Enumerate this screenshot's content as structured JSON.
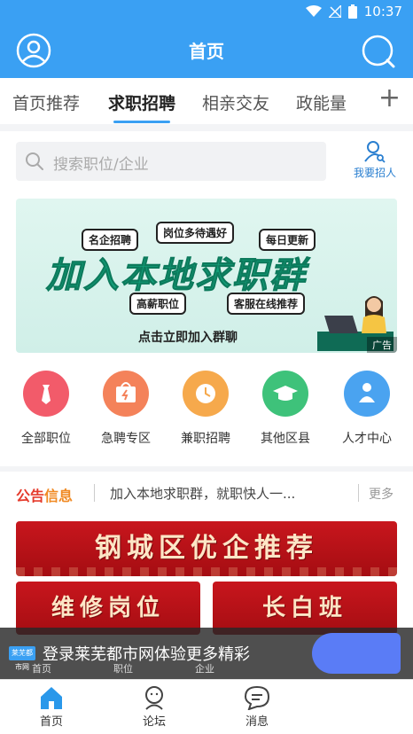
{
  "status_bar": {
    "time": "10:37"
  },
  "header": {
    "title": "首页"
  },
  "tabs": [
    {
      "label": "首页推荐"
    },
    {
      "label": "求职招聘"
    },
    {
      "label": "相亲交友"
    },
    {
      "label": "政能量"
    }
  ],
  "search": {
    "placeholder": "搜索职位/企业",
    "recruit_label": "我要招人"
  },
  "banner": {
    "tags": [
      "名企招聘",
      "岗位多待遇好",
      "每日更新",
      "高薪职位",
      "客服在线推荐"
    ],
    "title": "加入本地求职群",
    "cta": "点击立即加入群聊",
    "ad_label": "广告"
  },
  "categories": [
    {
      "label": "全部职位",
      "icon": "tie-icon",
      "color": "#f25b6a"
    },
    {
      "label": "急聘专区",
      "icon": "bag-icon",
      "color": "#f4825a"
    },
    {
      "label": "兼职招聘",
      "icon": "clock-icon",
      "color": "#f6a94c"
    },
    {
      "label": "其他区县",
      "icon": "graduation-cap-icon",
      "color": "#3ec27a"
    },
    {
      "label": "人才中心",
      "icon": "person-icon",
      "color": "#4aa3f0"
    }
  ],
  "notice": {
    "logo_a": "公告",
    "logo_b": "信息",
    "text": "加入本地求职群，就职快人一...",
    "more": "更多"
  },
  "promos": {
    "main": "钢城区优企推荐",
    "left": "维修岗位",
    "right": "长白班"
  },
  "overlay": {
    "logo": "莱芜都市网",
    "text": "登录莱芜都市网体验更多精彩",
    "ghost_labels": [
      "首页",
      "职位",
      "企业"
    ]
  },
  "bottom_nav": [
    {
      "label": "首页",
      "icon": "home-icon"
    },
    {
      "label": "论坛",
      "icon": "forum-icon"
    },
    {
      "label": "消息",
      "icon": "message-icon"
    }
  ]
}
